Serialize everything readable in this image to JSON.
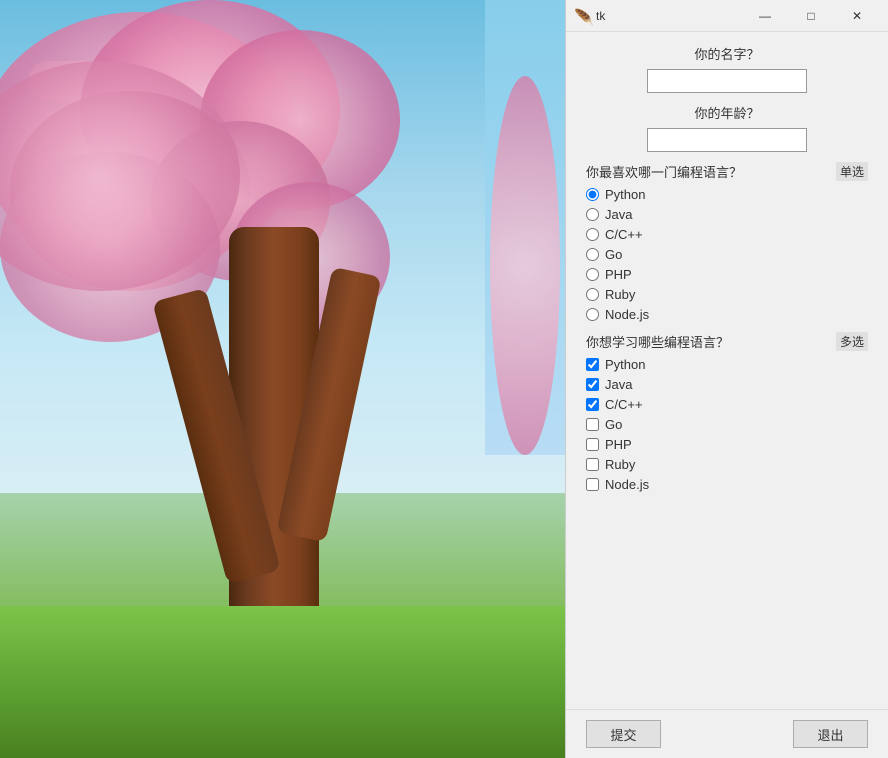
{
  "titlebar": {
    "icon": "🪶",
    "title": "tk",
    "minimize_label": "—",
    "maximize_label": "□",
    "close_label": "✕"
  },
  "form": {
    "name_label": "你的名字？",
    "age_label": "你的年龄？",
    "radio_question": "你最喜欢哪一门编程语言？",
    "radio_badge": "单选",
    "checkbox_question": "你想学习哪些编程语言？",
    "checkbox_badge": "多选",
    "radio_options": [
      {
        "id": "r_python",
        "label": "Python",
        "checked": true
      },
      {
        "id": "r_java",
        "label": "Java",
        "checked": false
      },
      {
        "id": "r_cpp",
        "label": "C/C++",
        "checked": false
      },
      {
        "id": "r_go",
        "label": "Go",
        "checked": false
      },
      {
        "id": "r_php",
        "label": "PHP",
        "checked": false
      },
      {
        "id": "r_ruby",
        "label": "Ruby",
        "checked": false
      },
      {
        "id": "r_nodejs",
        "label": "Node.js",
        "checked": false
      }
    ],
    "checkbox_options": [
      {
        "id": "c_python",
        "label": "Python",
        "checked": true
      },
      {
        "id": "c_java",
        "label": "Java",
        "checked": true
      },
      {
        "id": "c_cpp",
        "label": "C/C++",
        "checked": true
      },
      {
        "id": "c_go",
        "label": "Go",
        "checked": false
      },
      {
        "id": "c_php",
        "label": "PHP",
        "checked": false
      },
      {
        "id": "c_ruby",
        "label": "Ruby",
        "checked": false
      },
      {
        "id": "c_nodejs",
        "label": "Node.js",
        "checked": false
      }
    ],
    "submit_label": "提交",
    "exit_label": "退出"
  }
}
